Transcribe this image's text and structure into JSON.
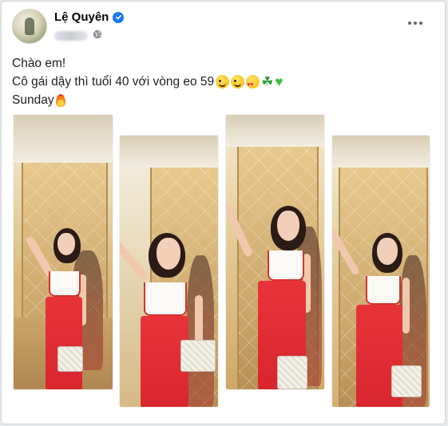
{
  "post": {
    "author": "Lệ Quyên",
    "verified": true,
    "privacy_icon": "globe-icon",
    "more_icon": "more-horizontal-icon"
  },
  "content": {
    "line1": "Chào em!",
    "line2": "Cô gái dậy thì tuổi 40 với vòng eo 59",
    "line2_emojis": [
      "smirk-face",
      "grin-face",
      "heart-eyes-face",
      "shamrock",
      "green-heart"
    ],
    "line3": "Sunday",
    "line3_emojis": [
      "fire"
    ]
  },
  "photos": [
    {
      "name": "photo-1"
    },
    {
      "name": "photo-2"
    },
    {
      "name": "photo-3"
    },
    {
      "name": "photo-4"
    }
  ],
  "colors": {
    "verified_blue": "#1877f2",
    "skirt_red": "#d9262e",
    "text": "#1c1e21"
  }
}
